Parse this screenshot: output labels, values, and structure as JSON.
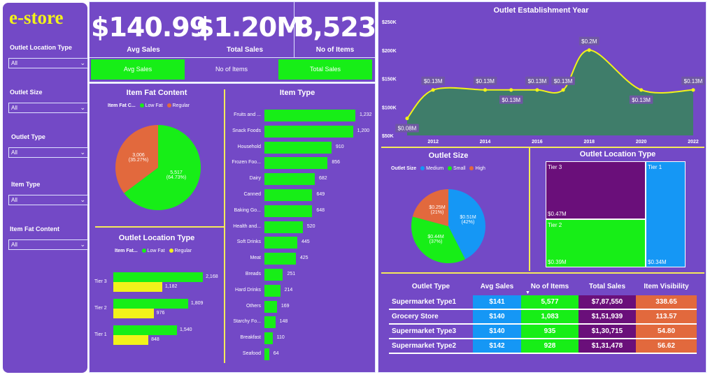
{
  "logo": {
    "text": "e-store"
  },
  "slicers": [
    {
      "label": "Outlet Location Type",
      "value": "All"
    },
    {
      "label": "Outlet Size",
      "value": "All"
    },
    {
      "label": "Outlet Type",
      "value": "All"
    },
    {
      "label": "Item Type",
      "value": "All"
    },
    {
      "label": "Item Fat Content",
      "value": "All"
    }
  ],
  "kpis": [
    {
      "value": "$140.99",
      "label": "Avg Sales"
    },
    {
      "value": "$1.20M",
      "label": "Total Sales"
    },
    {
      "value": "8,523",
      "label": "No of Items"
    }
  ],
  "buttons": [
    {
      "label": "Avg Sales",
      "active": true
    },
    {
      "label": "No of Items",
      "active": false
    },
    {
      "label": "Total Sales",
      "active": true
    }
  ],
  "colors": {
    "bg": "#7349c6",
    "green": "#17ee17",
    "orange": "#e2693d",
    "yellow": "#f2f21a",
    "blue": "#1597f5",
    "purple": "#6a0f7a",
    "area": "#3f7d6a"
  },
  "item_fat": {
    "title": "Item Fat Content",
    "legend_title": "Item Fat C...",
    "legend": [
      "Low Fat",
      "Regular"
    ],
    "slice_labels": [
      {
        "value": "5,517",
        "pct": "(64.73%)"
      },
      {
        "value": "3,006",
        "pct": "(35.27%)"
      }
    ]
  },
  "outlet_loc_bars": {
    "title": "Outlet Location Type",
    "legend_title": "Item Fat...",
    "legend": [
      "Low Fat",
      "Regular"
    ]
  },
  "item_type": {
    "title": "Item Type"
  },
  "est_year": {
    "title": "Outlet Establishment Year"
  },
  "outlet_size": {
    "title": "Outlet Size",
    "legend_title": "Outlet Size",
    "legend": [
      "Medium",
      "Small",
      "High"
    ],
    "slice_labels": [
      {
        "value": "$0.51M",
        "pct": "(42%)"
      },
      {
        "value": "$0.44M",
        "pct": "(37%)"
      },
      {
        "value": "$0.25M",
        "pct": "(21%)"
      }
    ]
  },
  "outlet_loc_tree": {
    "title": "Outlet Location Type",
    "tiles": [
      {
        "name": "Tier 3",
        "value": "$0.47M"
      },
      {
        "name": "Tier 2",
        "value": "$0.39M"
      },
      {
        "name": "Tier 1",
        "value": "$0.34M"
      }
    ]
  },
  "table": {
    "headers": [
      "Outlet Type",
      "Avg Sales",
      "No of Items",
      "Total Sales",
      "Item Visibility"
    ],
    "rows": [
      [
        "Supermarket Type1",
        "$141",
        "5,577",
        "$7,87,550",
        "338.65"
      ],
      [
        "Grocery Store",
        "$140",
        "1,083",
        "$1,51,939",
        "113.57"
      ],
      [
        "Supermarket Type3",
        "$140",
        "935",
        "$1,30,715",
        "54.80"
      ],
      [
        "Supermarket Type2",
        "$142",
        "928",
        "$1,31,478",
        "56.62"
      ]
    ]
  },
  "chart_data": [
    {
      "type": "pie",
      "title": "Item Fat Content",
      "categories": [
        "Low Fat",
        "Regular"
      ],
      "values": [
        5517,
        3006
      ],
      "percents": [
        64.73,
        35.27
      ]
    },
    {
      "type": "bar",
      "title": "Outlet Location Type",
      "categories": [
        "Tier 3",
        "Tier 2",
        "Tier 1"
      ],
      "series": [
        {
          "name": "Low Fat",
          "values": [
            2168,
            1809,
            1540
          ],
          "labels": [
            "2,168",
            "1,809",
            "1,540"
          ]
        },
        {
          "name": "Regular",
          "values": [
            1182,
            976,
            848
          ],
          "labels": [
            "1,182",
            "976",
            "848"
          ]
        }
      ]
    },
    {
      "type": "bar",
      "title": "Item Type",
      "categories": [
        "Fruits and ...",
        "Snack Foods",
        "Household",
        "Frozen Foo...",
        "Dairy",
        "Canned",
        "Baking Go...",
        "Health and...",
        "Soft Drinks",
        "Meat",
        "Breads",
        "Hard Drinks",
        "Others",
        "Starchy Fo...",
        "Breakfast",
        "Seafood"
      ],
      "values": [
        1232,
        1200,
        910,
        856,
        682,
        649,
        648,
        520,
        445,
        425,
        251,
        214,
        169,
        148,
        110,
        64
      ],
      "labels": [
        "1,232",
        "1,200",
        "910",
        "856",
        "682",
        "649",
        "648",
        "520",
        "445",
        "425",
        "251",
        "214",
        "169",
        "148",
        "110",
        "64"
      ]
    },
    {
      "type": "area",
      "title": "Outlet Establishment Year",
      "x": [
        2011,
        2012,
        2014,
        2015,
        2016,
        2017,
        2018,
        2020,
        2022
      ],
      "y": [
        0.08,
        0.13,
        0.13,
        0.13,
        0.13,
        0.13,
        0.2,
        0.13,
        0.13
      ],
      "point_labels": [
        "$0.08M",
        "$0.13M",
        "$0.13M",
        "$0.13M",
        "$0.13M",
        "$0.13M",
        "$0.2M",
        "$0.13M",
        "$0.13M"
      ],
      "y_ticks": [
        "$50K",
        "$100K",
        "$150K",
        "$200K",
        "$250K"
      ],
      "y_tick_values": [
        0.05,
        0.1,
        0.15,
        0.2,
        0.25
      ],
      "x_ticks": [
        2012,
        2014,
        2016,
        2018,
        2020,
        2022
      ],
      "ylim": [
        0.05,
        0.25
      ]
    },
    {
      "type": "pie",
      "title": "Outlet Size",
      "categories": [
        "Medium",
        "Small",
        "High"
      ],
      "values": [
        0.51,
        0.44,
        0.25
      ],
      "percents": [
        42,
        37,
        21
      ]
    }
  ]
}
